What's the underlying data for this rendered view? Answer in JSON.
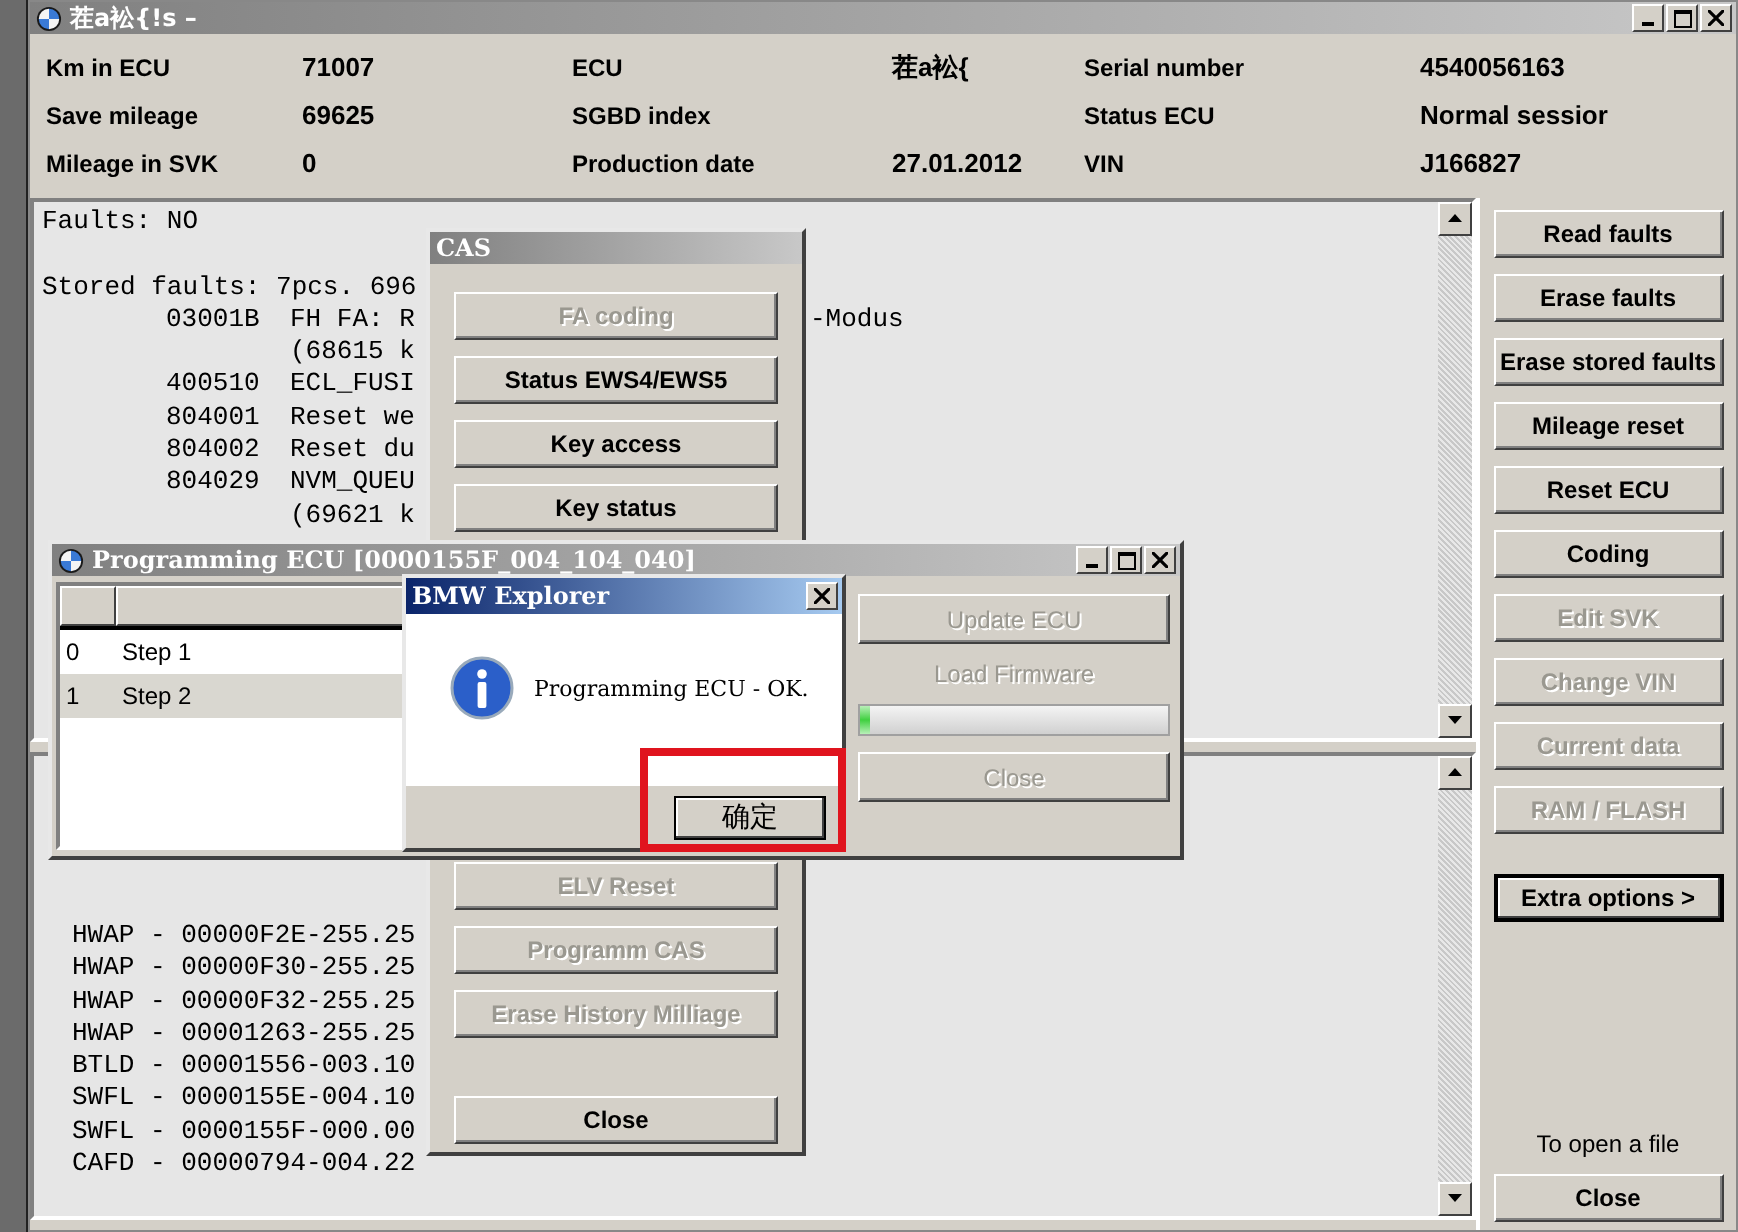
{
  "main_window": {
    "title": "茬a衳{!s –"
  },
  "info": [
    {
      "label": "Km in ECU",
      "value": "71007"
    },
    {
      "label": "ECU",
      "value": "茬a衳{"
    },
    {
      "label": "Serial number",
      "value": "4540056163"
    },
    {
      "label": "Save mileage",
      "value": "69625"
    },
    {
      "label": "SGBD index"
    },
    {
      "label": "Status ECU",
      "value": "Normal sessior"
    },
    {
      "label": "Mileage in SVK",
      "value": "0"
    },
    {
      "label": "Production date",
      "value": "27.01.2012"
    },
    {
      "label": "VIN",
      "value": "J166827"
    }
  ],
  "faults_log": {
    "lines": [
      {
        "kind": "plain",
        "text": "Faults: NO"
      },
      {
        "kind": "blank"
      },
      {
        "kind": "plain",
        "text": "Stored faults: 7pcs. 696"
      },
      {
        "kind": "fault",
        "code": "03001B",
        "text": "FH FA: R",
        "tail": "-Modus"
      },
      {
        "kind": "cont",
        "text": "(68615 k"
      },
      {
        "kind": "fault",
        "code": "400510",
        "text": "ECL_FUSI"
      },
      {
        "kind": "fault",
        "code": "804001",
        "text": "Reset we"
      },
      {
        "kind": "fault",
        "code": "804002",
        "text": "Reset du"
      },
      {
        "kind": "fault",
        "code": "804029",
        "text": "NVM_QUEU"
      },
      {
        "kind": "cont",
        "text": "(69621 k"
      }
    ]
  },
  "history_log": {
    "lines": [
      "HWAP - 00000F2E-255.25",
      "HWAP - 00000F30-255.25",
      "HWAP - 00000F32-255.25",
      "HWAP - 00001263-255.25",
      "BTLD - 00001556-003.10",
      "SWFL - 0000155E-004.10",
      "SWFL - 0000155F-000.00",
      "CAFD - 00000794-004.22"
    ]
  },
  "side_buttons": [
    {
      "label": "Read faults",
      "disabled": false,
      "default": false
    },
    {
      "label": "Erase faults",
      "disabled": false,
      "default": false
    },
    {
      "label": "Erase stored faults",
      "disabled": false,
      "default": false
    },
    {
      "label": "Mileage reset",
      "disabled": false,
      "default": false
    },
    {
      "label": "Reset ECU",
      "disabled": false,
      "default": false
    },
    {
      "label": "Coding",
      "disabled": false,
      "default": false
    },
    {
      "label": "Edit SVK",
      "disabled": true,
      "default": false
    },
    {
      "label": "Change VIN",
      "disabled": true,
      "default": false
    },
    {
      "label": "Current data",
      "disabled": true,
      "default": false
    },
    {
      "label": "RAM / FLASH",
      "disabled": true,
      "default": false
    },
    {
      "label": "Extra options >",
      "disabled": false,
      "default": true
    }
  ],
  "open_file_note": "To open a file",
  "close_button": "Close",
  "cas_window": {
    "title": "CAS",
    "top_buttons": [
      {
        "label": "FA coding",
        "disabled": true
      },
      {
        "label": "Status EWS4/EWS5",
        "disabled": false
      },
      {
        "label": "Key access",
        "disabled": false
      },
      {
        "label": "Key status",
        "disabled": false
      }
    ],
    "bottom_buttons": [
      {
        "label": "ELV Reset",
        "disabled": true
      },
      {
        "label": "Programm CAS",
        "disabled": true
      },
      {
        "label": "Erase History Milliage",
        "disabled": true
      }
    ],
    "close_button": "Close"
  },
  "programming_window": {
    "title": "Programming ECU [0000155F_004_104_040]",
    "rows": [
      {
        "index": "0",
        "step": "Step 1",
        "selected": false
      },
      {
        "index": "1",
        "step": "Step 2",
        "selected": true
      }
    ],
    "update_button": {
      "label": "Update ECU",
      "disabled": true
    },
    "firmware_label": "Load Firmware",
    "progress": {
      "level": 0.03
    },
    "close_button": {
      "label": "Close",
      "disabled": true
    }
  },
  "message_box": {
    "title": "BMW Explorer",
    "text": "Programming ECU - OK.",
    "button": "确定"
  }
}
